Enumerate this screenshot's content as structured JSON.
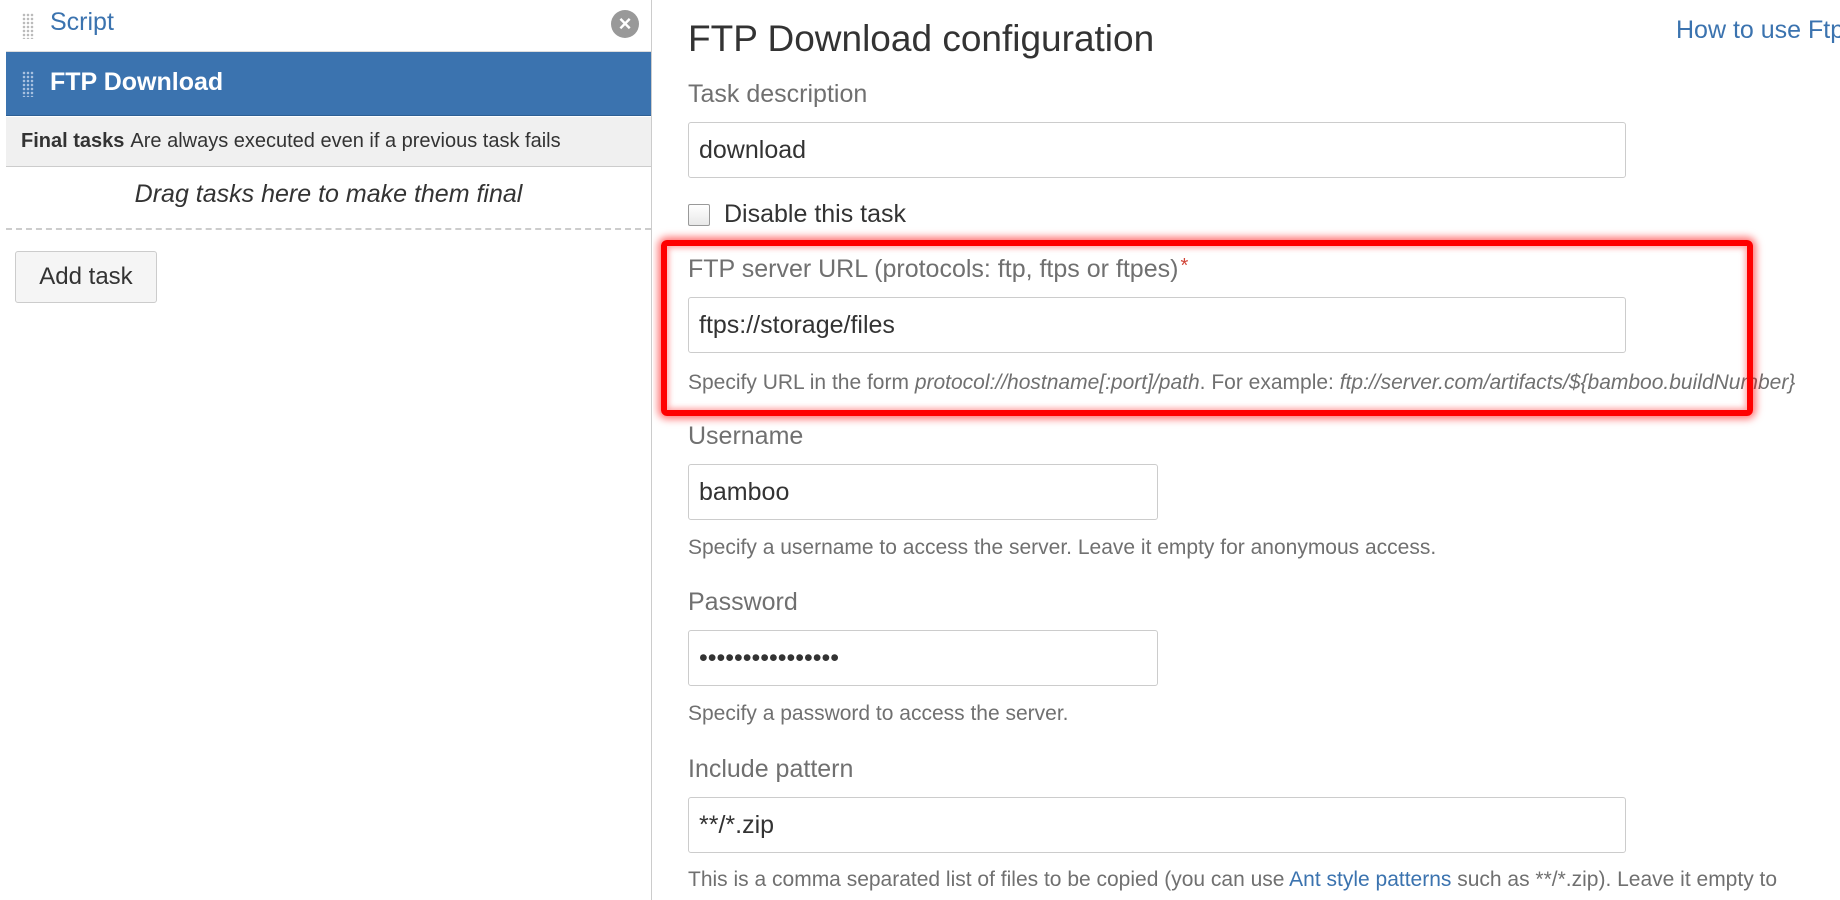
{
  "task_list": {
    "items": [
      {
        "label": "Script",
        "selected": false
      },
      {
        "label": "FTP Download",
        "selected": true
      }
    ],
    "final_tasks": {
      "title": "Final tasks",
      "description": "Are always executed even if a previous task fails",
      "drop_hint": "Drag tasks here to make them final"
    },
    "add_task_label": "Add task"
  },
  "config": {
    "title": "FTP Download configuration",
    "help_link": "How to use Ftp",
    "task_description": {
      "label": "Task description",
      "value": "download"
    },
    "disable_task": {
      "label": "Disable this task",
      "checked": false
    },
    "server_url": {
      "label": "FTP server URL (protocols: ftp, ftps or ftpes)",
      "required_mark": "*",
      "value": "ftps://storage/files",
      "help_prefix": "Specify URL in the form ",
      "help_form": "protocol://hostname[:port]/path",
      "help_middle": ". For example: ",
      "help_example": "ftp://server.com/artifacts/${bamboo.buildNumber}"
    },
    "username": {
      "label": "Username",
      "value": "bamboo",
      "help": "Specify a username to access the server. Leave it empty for anonymous access."
    },
    "password": {
      "label": "Password",
      "value": "••••••••••••••••",
      "help": "Specify a password to access the server."
    },
    "include_pattern": {
      "label": "Include pattern",
      "value": "**/*.zip",
      "help_prefix": "This is a comma separated list of files to be copied (you can use ",
      "help_link": "Ant style patterns",
      "help_suffix": " such as **/*.zip). Leave it empty to"
    }
  },
  "colors": {
    "accent": "#3b73af",
    "highlight": "#ff0000",
    "required": "#d04437"
  }
}
